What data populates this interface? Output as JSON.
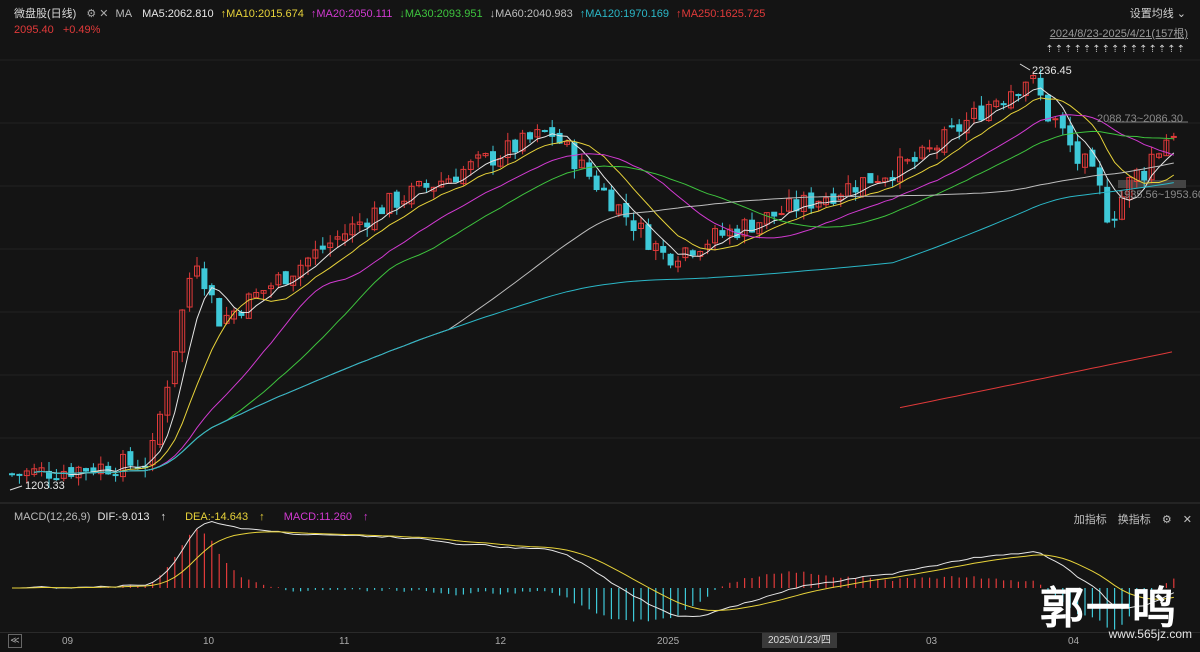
{
  "title_bar": {
    "stock_name": "微盘股",
    "period": "(日线)",
    "ma_tag": "MA",
    "settings_label": "设置均线",
    "range": "2024/8/23-2025/4/21(157根)"
  },
  "ma_legend": [
    {
      "label": "MA5:2062.810",
      "arrow": "",
      "color": "#e6e6e6"
    },
    {
      "label": "MA10:2015.674",
      "arrow": "↑",
      "color": "#e7d23a"
    },
    {
      "label": "MA20:2050.111",
      "arrow": "↑",
      "color": "#d13ad1"
    },
    {
      "label": "MA30:2093.951",
      "arrow": "↓",
      "color": "#3ec43e"
    },
    {
      "label": "MA60:2040.983",
      "arrow": "↓",
      "color": "#bdbdbd"
    },
    {
      "label": "MA120:1970.169",
      "arrow": "↑",
      "color": "#2bb7c7"
    },
    {
      "label": "MA250:1625.725",
      "arrow": "↑",
      "color": "#e03a3a"
    }
  ],
  "price": {
    "last": "2095.40",
    "change": "+0.49%"
  },
  "annotations": {
    "high": "2236.45",
    "low": "1203.33",
    "zone_upper": "2088.73~2086.30",
    "zone_lower": "1935.56~1953.60",
    "arrow_row": "⇡⇡⇡⇡⇡⇡⇡⇡⇡⇡⇡⇡⇡⇡⇡"
  },
  "macd": {
    "name": "MACD(12,26,9)",
    "dif": "DIF:-9.013",
    "dif_arrow": "↑",
    "dea": "DEA:-14.643",
    "dea_arrow": "↑",
    "macd": "MACD:11.260",
    "macd_arrow": "↑",
    "tools": [
      "加指标",
      "换指标",
      "⚙",
      "✕"
    ]
  },
  "x_axis": {
    "ticks": [
      {
        "label": "09",
        "x": 62
      },
      {
        "label": "10",
        "x": 203
      },
      {
        "label": "11",
        "x": 339
      },
      {
        "label": "12",
        "x": 495
      },
      {
        "label": "2025",
        "x": 657
      },
      {
        "label": "03",
        "x": 926
      },
      {
        "label": "04",
        "x": 1068
      }
    ],
    "crosshair_date": "2025/01/23/四",
    "collapse_icon": "≪"
  },
  "watermark": {
    "text": "郭一鸣",
    "url": "www.565jz.com"
  },
  "colors": {
    "up": "#e03a3a",
    "down": "#3ec9d8",
    "bg": "#141414"
  },
  "chart_data": {
    "type": "candlestick",
    "y_range": [
      1203.33,
      2236.45
    ],
    "keypoints": [
      {
        "date": "2024/8/23",
        "close": 1230
      },
      {
        "date": "2024/9/24",
        "close": 1260
      },
      {
        "date": "2024/10/08",
        "close": 1780
      },
      {
        "date": "2024/10/15",
        "close": 1610
      },
      {
        "date": "2024/11/20",
        "close": 1890
      },
      {
        "date": "2024/12/13",
        "close": 2080
      },
      {
        "date": "2024/12/31",
        "close": 1940
      },
      {
        "date": "2025/01/13",
        "close": 1770
      },
      {
        "date": "2025/02/28",
        "close": 2010
      },
      {
        "date": "2025/03/14",
        "close": 2220
      },
      {
        "date": "2025/04/07",
        "close": 1880
      },
      {
        "date": "2025/04/21",
        "close": 2095.4
      }
    ]
  }
}
